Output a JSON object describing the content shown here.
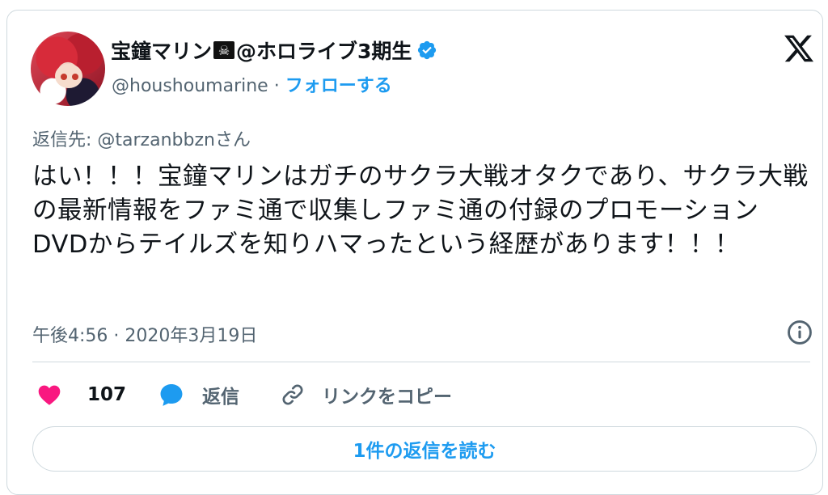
{
  "author": {
    "name_prefix": "宝鐘マリン",
    "name_emoji": "☠",
    "name_suffix": "@ホロライブ3期生",
    "handle": "@houshoumarine",
    "separator": "·",
    "follow_label": "フォローする"
  },
  "reply_to": "返信先: @tarzanbbznさん",
  "tweet_text": "はい！！！宝鐘マリンはガチのサクラ大戦オタクであり、サクラ大戦の最新情報をファミ通で収集しファミ通の付録のプロモーションDVDからテイルズを知りハマったという経歴があります！！！",
  "timestamp": "午後4:56 · 2020年3月19日",
  "actions": {
    "like_count": "107",
    "reply_label": "返信",
    "copy_link_label": "リンクをコピー"
  },
  "read_replies_label": "1件の返信を読む",
  "colors": {
    "accent": "#1d9bf0",
    "like": "#f91880",
    "secondary_text": "#536471"
  }
}
